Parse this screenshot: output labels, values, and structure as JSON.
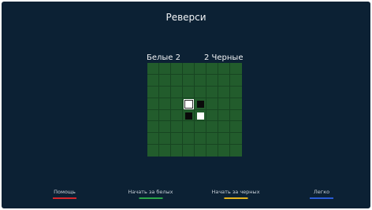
{
  "title": "Реверси",
  "score": {
    "white_label": "Белые 2",
    "black_label": "2 Черные",
    "white_count": 2,
    "black_count": 2
  },
  "board": {
    "size": 8,
    "grid": [
      ".........",
      "........",
      "........",
      "...WB...",
      "...BW...",
      "........",
      "........",
      "........"
    ],
    "selected": [
      3,
      3
    ]
  },
  "footer": {
    "buttons": [
      {
        "label": "Помощь",
        "color": "#d6262b"
      },
      {
        "label": "Начать за белых",
        "color": "#2ca64a"
      },
      {
        "label": "Начать за черных",
        "color": "#e5b31c"
      },
      {
        "label": "Легко",
        "color": "#2a5bd7"
      }
    ]
  },
  "colors": {
    "background": "#0c2134",
    "board": "#225c2c"
  }
}
